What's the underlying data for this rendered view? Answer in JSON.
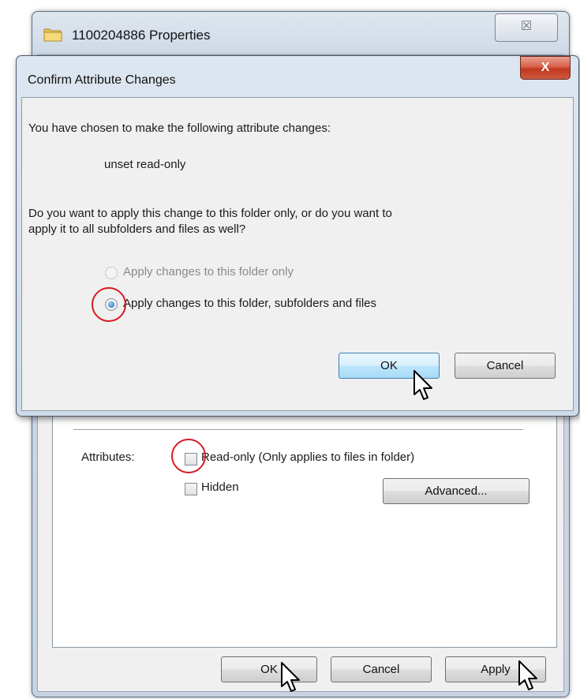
{
  "properties_window": {
    "title": "1100204886 Properties",
    "close_glyph": "☒",
    "attributes_label": "Attributes:",
    "readonly_label": "Read-only (Only applies to files in folder)",
    "hidden_label": "Hidden",
    "advanced_button": "Advanced...",
    "ok_button": "OK",
    "cancel_button": "Cancel",
    "apply_button": "Apply"
  },
  "confirm_dialog": {
    "title": "Confirm Attribute Changes",
    "close_glyph": "X",
    "intro_text": "You have chosen to make the following attribute changes:",
    "change_item": "unset read-only",
    "question_line1": "Do you want to apply this change to this folder only, or do you want to",
    "question_line2": "apply it to all subfolders and files as well?",
    "radio_option_1": "Apply changes to this folder only",
    "radio_option_2": "Apply changes to this folder, subfolders and files",
    "selected_option": 2,
    "ok_button": "OK",
    "cancel_button": "Cancel"
  },
  "colors": {
    "highlight_ring": "#d61a22",
    "close_button_red": "#c0381f",
    "default_button_blue": "#3c7fb1"
  },
  "icons": [
    "folder-icon",
    "close-icon",
    "cursor-icon"
  ]
}
